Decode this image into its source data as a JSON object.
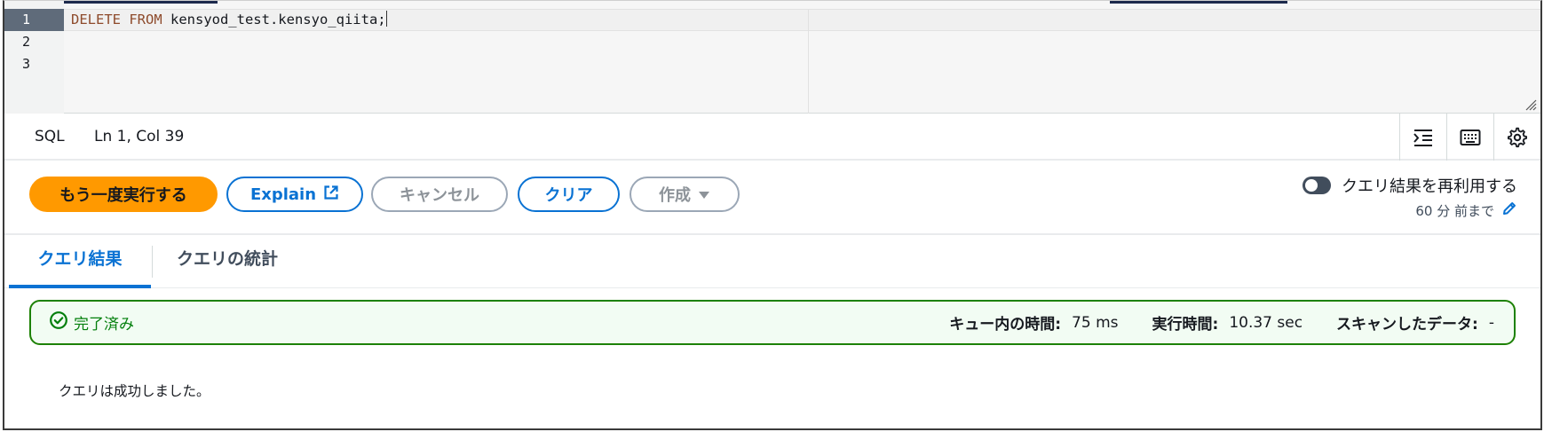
{
  "editor": {
    "line_numbers": [
      "1",
      "2",
      "3"
    ],
    "code_keyword": "DELETE FROM",
    "code_rest": " kensyod_test.kensyo_qiita;"
  },
  "statusbar": {
    "language": "SQL",
    "position": "Ln 1, Col 39",
    "icons": [
      "indent-icon",
      "keyboard-icon",
      "settings-icon"
    ]
  },
  "toolbar": {
    "run_again": "もう一度実行する",
    "explain": "Explain",
    "cancel": "キャンセル",
    "clear": "クリア",
    "create": "作成",
    "reuse_label": "クエリ結果を再利用する",
    "reuse_window": "60 分 前まで",
    "reuse_enabled": false
  },
  "tabs": {
    "results": "クエリ結果",
    "stats": "クエリの統計"
  },
  "status": {
    "label": "完了済み",
    "queue_label": "キュー内の時間:",
    "queue_value": "75 ms",
    "exec_label": "実行時間:",
    "exec_value": "10.37 sec",
    "scan_label": "スキャンしたデータ:",
    "scan_value": "-"
  },
  "message": "クエリは成功しました。",
  "colors": {
    "primary": "#ff9900",
    "link": "#0972d3",
    "success": "#037f0c"
  }
}
